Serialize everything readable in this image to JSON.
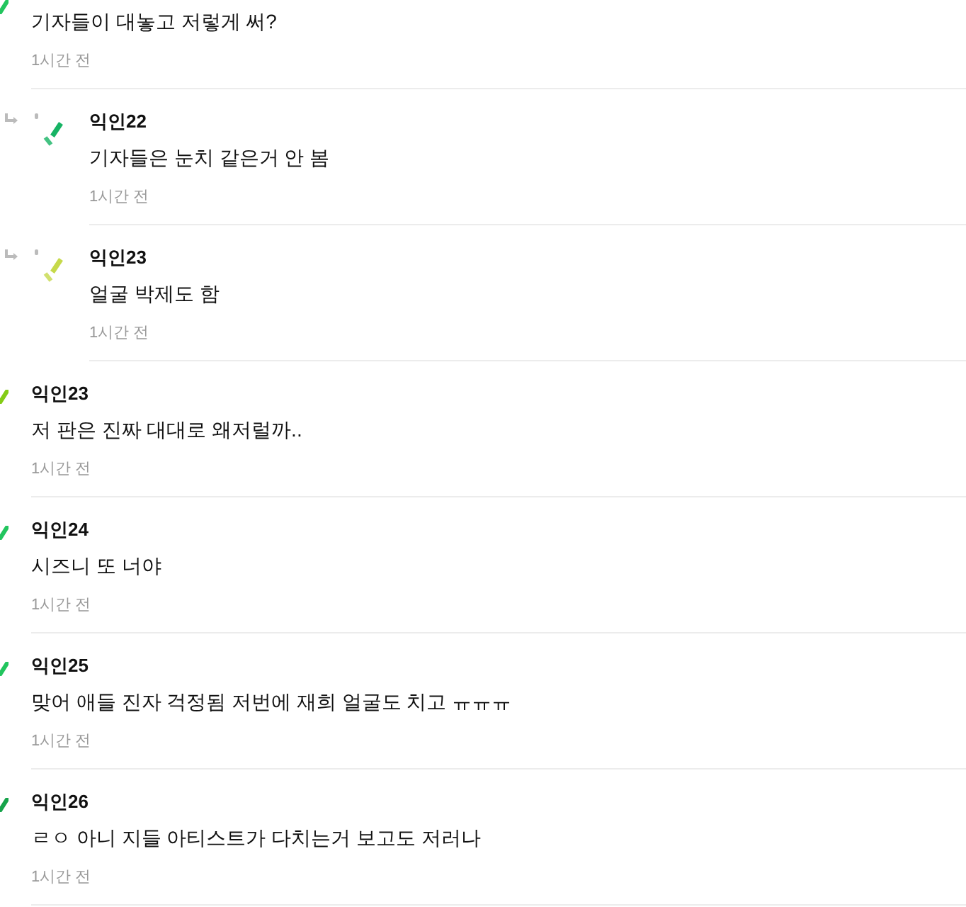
{
  "comments": [
    {
      "kind": "top",
      "text": "기자들이 대놓고 저렇게 써?",
      "time": "1시간 전",
      "color": "#22c55e"
    },
    {
      "kind": "reply",
      "author": "익인22",
      "text": "기자들은 눈치 같은거 안 봄",
      "time": "1시간 전",
      "color": "#16b364"
    },
    {
      "kind": "reply",
      "author": "익인23",
      "text": "얼굴 박제도 함",
      "time": "1시간 전",
      "color": "#c6d94a"
    },
    {
      "kind": "top",
      "author": "익인23",
      "text": "저 판은 진짜 대대로 왜저럴까..",
      "time": "1시간 전",
      "color": "#84cc16"
    },
    {
      "kind": "top",
      "author": "익인24",
      "text": "시즈니 또 너야",
      "time": "1시간 전",
      "color": "#22c55e"
    },
    {
      "kind": "top",
      "author": "익인25",
      "text": "맞어 애들 진자 걱정됨 저번에 재희 얼굴도 치고 ㅠㅠㅠ",
      "time": "1시간 전",
      "color": "#22c55e"
    },
    {
      "kind": "top",
      "author": "익인26",
      "text": "ㄹㅇ 아니 지들 아티스트가 다치는거 보고도 저러나",
      "time": "1시간 전",
      "color": "#16a34a"
    }
  ]
}
